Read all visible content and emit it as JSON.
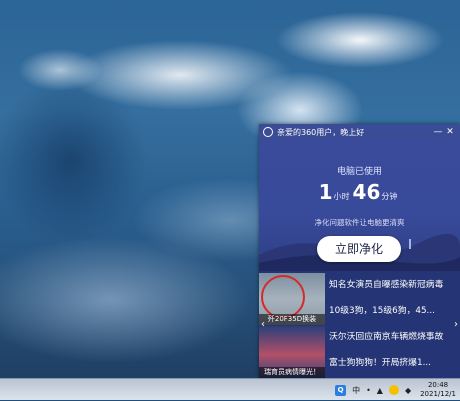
{
  "popup": {
    "header_title": "亲爱的360用户，晚上好",
    "minimize_icon": "minus-icon",
    "close_icon": "close-icon",
    "used_label": "电脑已使用",
    "hours": "1",
    "hours_unit": "小时",
    "minutes": "46",
    "minutes_unit": "分钟",
    "hint": "净化问题软件让电脑更清爽",
    "clean_button": "立即净化"
  },
  "news": [
    {
      "caption": "歼20F35D换装",
      "headline": "知名女演员自曝感染新冠病毒"
    },
    {
      "caption": "",
      "headline": "10级3狗，15级6狗，45..."
    },
    {
      "caption": "瑞育员病情曝光！",
      "headline": "沃尔沃回应南京车辆燃烧事故"
    },
    {
      "caption": "",
      "headline": "富士狗狗狗！开局挤爆1..."
    }
  ],
  "taskbar": {
    "ime": "中",
    "clock_time": "20:48",
    "clock_date": "2021/12/1"
  },
  "colors": {
    "popup_bg": "#2a3a86",
    "accent_red": "#d42a2a"
  }
}
